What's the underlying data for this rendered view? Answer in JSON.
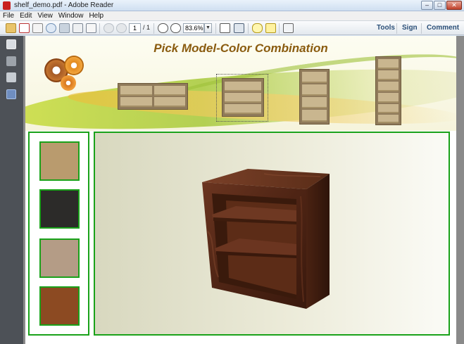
{
  "window": {
    "title": "shelf_demo.pdf - Adobe Reader"
  },
  "menu": {
    "items": [
      "File",
      "Edit",
      "View",
      "Window",
      "Help"
    ]
  },
  "toolbar": {
    "page_current": "1",
    "page_total": "/ 1",
    "zoom": "83.6%",
    "links": {
      "tools": "Tools",
      "sign": "Sign",
      "comment": "Comment"
    }
  },
  "banner": {
    "title": "Pick Model-Color Combination"
  },
  "colors": {
    "panel_border": "#1aa21a",
    "title_color": "#8a5b0f",
    "swatches": [
      "#b99b6e",
      "#2c2b29",
      "#b49c86",
      "#8c4a22"
    ],
    "shelf_wood": "#5b2d1a"
  },
  "swatches": [
    {
      "name": "maple",
      "color": "#b99b6e"
    },
    {
      "name": "black",
      "color": "#2c2b29"
    },
    {
      "name": "whitewash",
      "color": "#b49c86"
    },
    {
      "name": "cherry",
      "color": "#8c4a22"
    }
  ],
  "models": [
    {
      "name": "wide-low-shelf"
    },
    {
      "name": "cube-shelf",
      "selected": true
    },
    {
      "name": "four-shelf"
    },
    {
      "name": "tall-shelf"
    }
  ]
}
